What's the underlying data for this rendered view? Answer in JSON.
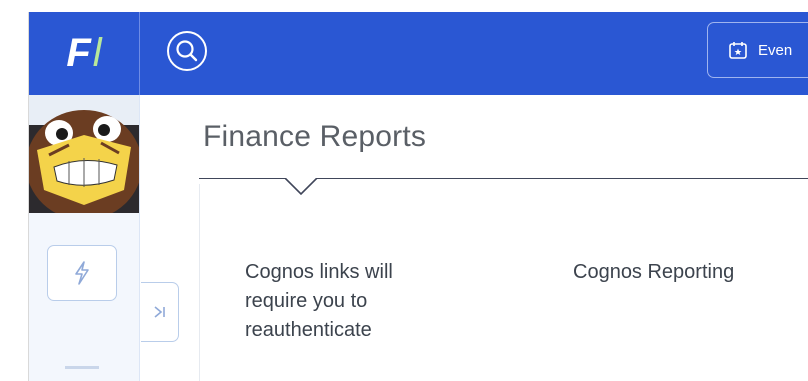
{
  "header": {
    "logo_letter_1": "F",
    "logo_letter_2": "l",
    "events_label": "Even",
    "brand_color": "#2a57d3",
    "search_icon": "search-icon",
    "events_icon": "calendar-icon"
  },
  "sidebar": {
    "shortcut_icon": "lightning-icon",
    "expand_icon": "expand-panel-icon",
    "avatar": "mascot-avatar"
  },
  "main": {
    "title": "Finance Reports",
    "cards": [
      {
        "lines": [
          "Cognos links will",
          "require you to",
          "reauthenticate"
        ]
      },
      {
        "lines": [
          "Cognos Reporting"
        ]
      }
    ]
  }
}
